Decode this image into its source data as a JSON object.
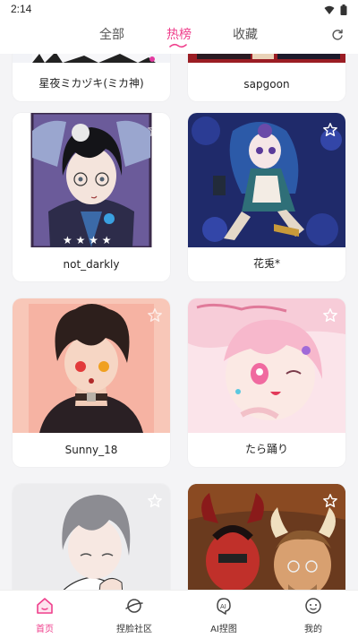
{
  "status": {
    "time": "2:14"
  },
  "tabs": [
    {
      "label": "全部"
    },
    {
      "label": "热榜"
    },
    {
      "label": "收藏"
    }
  ],
  "cards": [
    {
      "label": "星夜ミカヅキ(ミカ神)"
    },
    {
      "label": "sapgoon"
    },
    {
      "label": "not_darkly"
    },
    {
      "label": "花兎*"
    },
    {
      "label": "Sunny_18"
    },
    {
      "label": "たら踊り"
    },
    {
      "label": ""
    },
    {
      "label": ""
    }
  ],
  "bottom_nav": [
    {
      "label": "首页"
    },
    {
      "label": "捏脸社区"
    },
    {
      "label": "AI捏图"
    },
    {
      "label": "我的"
    }
  ],
  "colors": {
    "accent": "#ef3f8c"
  },
  "icons": [
    "wifi-icon",
    "battery-icon",
    "refresh-icon",
    "star-icon",
    "home-icon",
    "planet-icon",
    "ai-icon",
    "smile-icon"
  ]
}
